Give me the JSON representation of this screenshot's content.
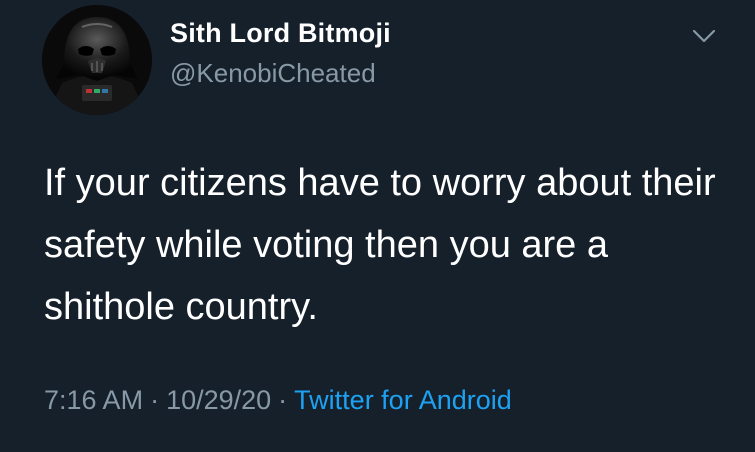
{
  "tweet": {
    "author": {
      "display_name": "Sith Lord Bitmoji",
      "handle": "@KenobiCheated",
      "avatar_icon": "darth-vader-avatar"
    },
    "text": "If your citizens have to worry about their safety while voting then you are a shithole country.",
    "time": "7:16 AM",
    "separator": "·",
    "date": "10/29/20",
    "source": "Twitter for Android",
    "menu_icon": "chevron-down-icon"
  },
  "colors": {
    "background": "#15202b",
    "primary_text": "#ffffff",
    "secondary_text": "#8899a6",
    "link": "#1da1f2"
  }
}
